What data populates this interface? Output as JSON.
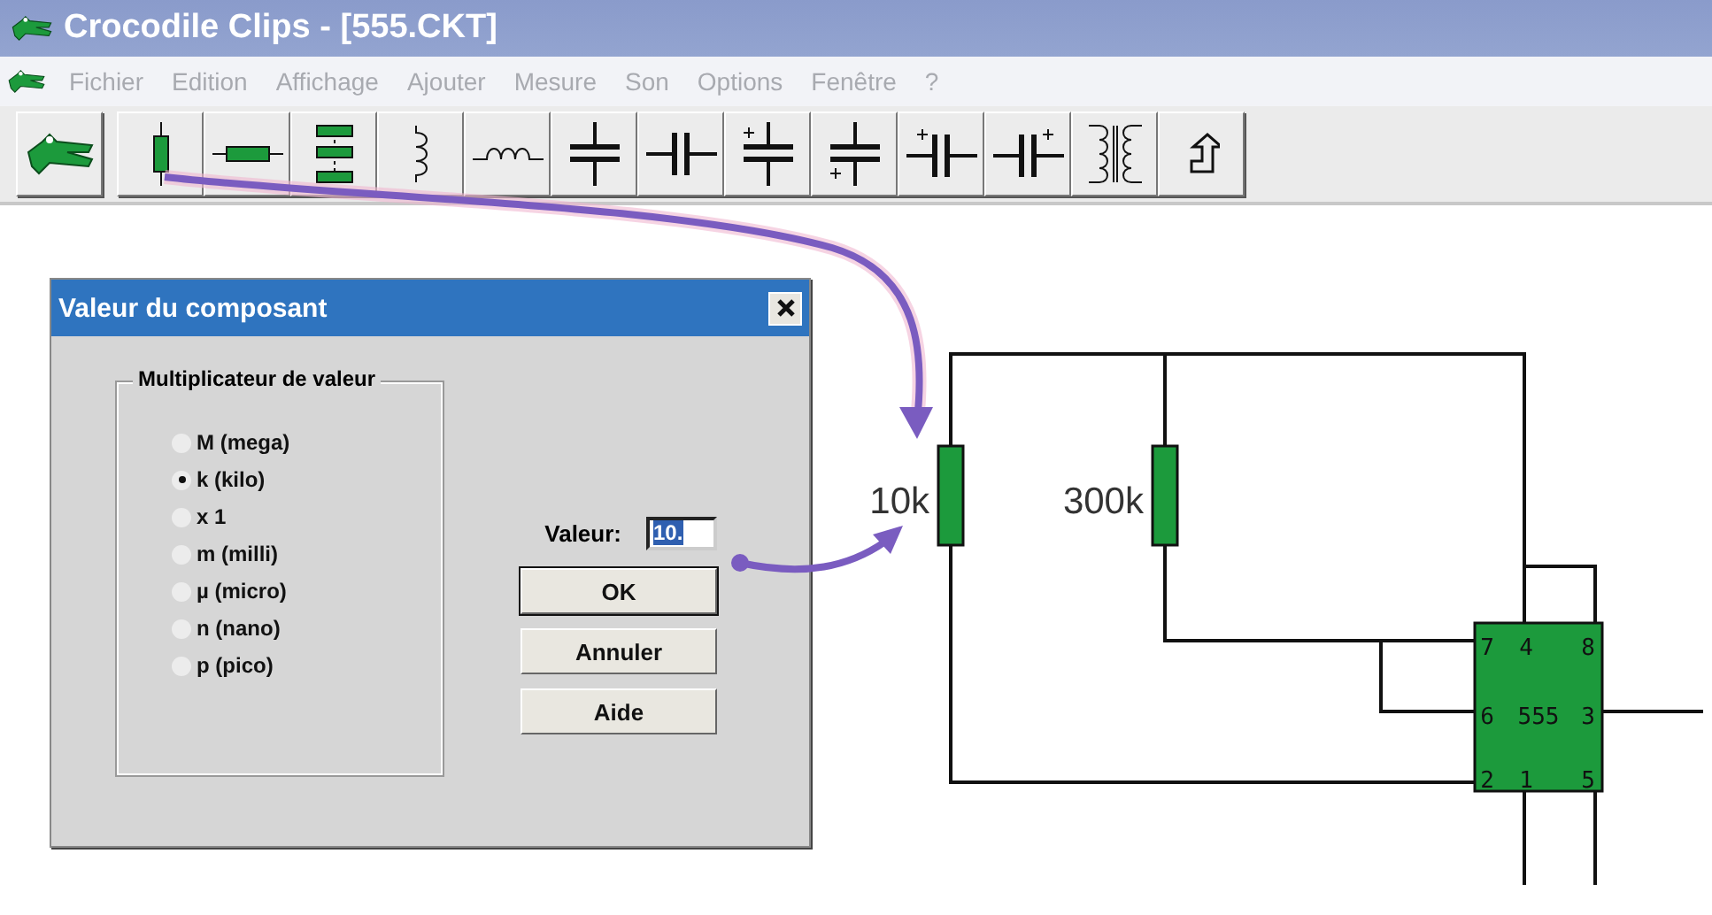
{
  "window": {
    "title": "Crocodile Clips - [555.CKT]"
  },
  "menu": [
    {
      "label": "Fichier",
      "disabled": true
    },
    {
      "label": "Edition",
      "disabled": true
    },
    {
      "label": "Affichage",
      "disabled": true
    },
    {
      "label": "Ajouter",
      "disabled": true
    },
    {
      "label": "Mesure",
      "disabled": true
    },
    {
      "label": "Son",
      "disabled": true
    },
    {
      "label": "Options",
      "disabled": true
    },
    {
      "label": "Fenêtre",
      "disabled": true
    },
    {
      "label": "?",
      "disabled": true
    }
  ],
  "toolbar": [
    {
      "kind": "crocodile"
    },
    {
      "kind": "resistor-vertical"
    },
    {
      "kind": "resistor-horizontal"
    },
    {
      "kind": "resistor-bank"
    },
    {
      "kind": "inductor-vertical"
    },
    {
      "kind": "inductor-horizontal"
    },
    {
      "kind": "capacitor-horizontal"
    },
    {
      "kind": "capacitor-vertical"
    },
    {
      "kind": "polarized-top"
    },
    {
      "kind": "polarized-bottom"
    },
    {
      "kind": "polarized-left"
    },
    {
      "kind": "polarized-right"
    },
    {
      "kind": "transformer"
    },
    {
      "kind": "rotate"
    }
  ],
  "dialog": {
    "title": "Valeur du composant",
    "group_label": "Multiplicateur de valeur",
    "options": [
      {
        "label": "M (mega)",
        "selected": false
      },
      {
        "label": "k (kilo)",
        "selected": true
      },
      {
        "label": "x 1",
        "selected": false
      },
      {
        "label": "m (milli)",
        "selected": false
      },
      {
        "label": "µ (micro)",
        "selected": false
      },
      {
        "label": "n (nano)",
        "selected": false
      },
      {
        "label": "p (pico)",
        "selected": false
      }
    ],
    "value_label": "Valeur:",
    "value": "10.",
    "buttons": [
      {
        "label": "OK",
        "default": true
      },
      {
        "label": "Annuler",
        "default": false
      },
      {
        "label": "Aide",
        "default": false
      }
    ]
  },
  "circuit": {
    "resistors": [
      {
        "label": "10k"
      },
      {
        "label": "300k"
      }
    ],
    "chip": {
      "label": "555",
      "pins": [
        "7",
        "4",
        "8",
        "6",
        "3",
        "2",
        "1",
        "5"
      ]
    }
  }
}
